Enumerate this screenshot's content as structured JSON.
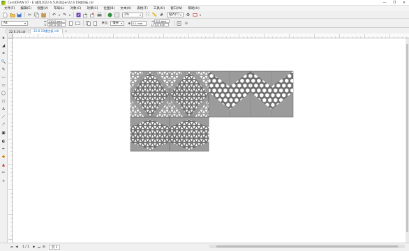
{
  "titlebar": {
    "title": "CorelDRAW X7 - E:\\通用2022.6.5\\吊顶设计\\22.6.19镂空板.cdr",
    "controls": [
      "—",
      "❐",
      "✕"
    ]
  },
  "menu": [
    "文件(F)",
    "编辑(E)",
    "视图(V)",
    "布局(L)",
    "对象(C)",
    "效果(C)",
    "位图(B)",
    "文本(X)",
    "表格(T)",
    "工具(O)",
    "窗口(W)",
    "帮助(H)"
  ],
  "toolbar": {
    "zoom_value": "2%",
    "snap_label": "贴齐(T)"
  },
  "propertybar": {
    "paper_size": "A4",
    "width_value": "210.0 mm",
    "height_value": "297.0 mm",
    "units_label": "单位:",
    "units_value": "毫米",
    "nudge_value": "0.1 mm",
    "dup_x_value": "5.0 mm",
    "dup_y_value": "5.0 mm"
  },
  "tabs": [
    {
      "label": "22.6.16.cdr",
      "active": false
    },
    {
      "label": "22.6.19镂空板.cdr",
      "active": true
    }
  ],
  "status": {
    "page_counter": "1 / 1",
    "page_tab": "页 1"
  },
  "colors": {
    "panel_fill": "#9b9b9b",
    "panel_dark": "#6e6e6e",
    "hole": "#ffffff",
    "active_tab_text": "#1565c0"
  }
}
